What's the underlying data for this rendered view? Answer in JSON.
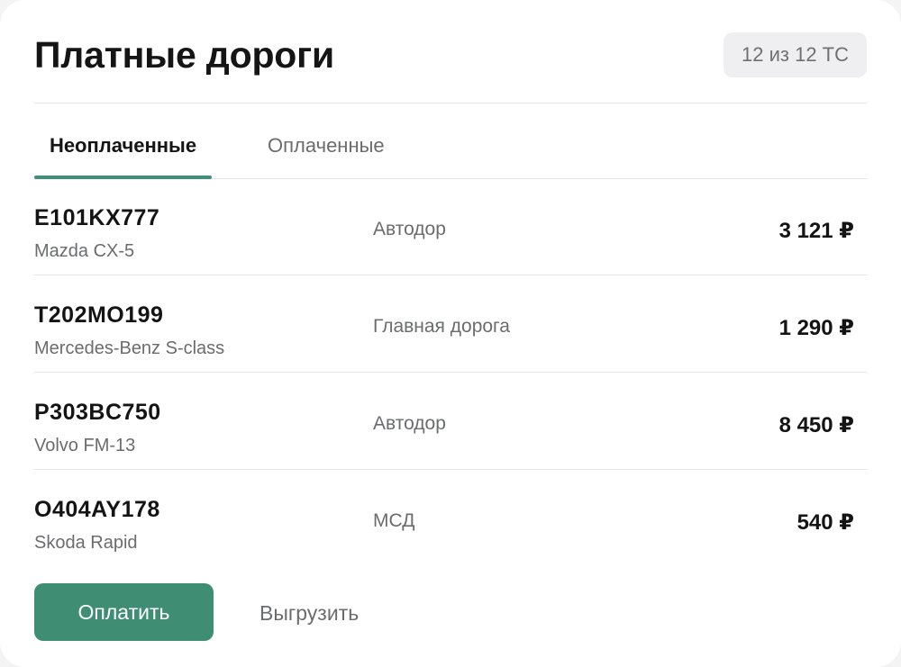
{
  "header": {
    "title": "Платные дороги",
    "count_badge": "12 из 12 ТС"
  },
  "tabs": [
    {
      "label": "Неоплаченные",
      "active": true
    },
    {
      "label": "Оплаченные",
      "active": false
    }
  ],
  "rows": [
    {
      "plate": "E101KX777",
      "model": "Mazda CX-5",
      "operator": "Автодор",
      "amount": "3 121 ₽"
    },
    {
      "plate": "T202MO199",
      "model": "Mercedes-Benz S-class",
      "operator": "Главная дорога",
      "amount": "1 290 ₽"
    },
    {
      "plate": "P303BC750",
      "model": "Volvo FM-13",
      "operator": "Автодор",
      "amount": "8 450 ₽"
    },
    {
      "plate": "O404AY178",
      "model": "Skoda Rapid",
      "operator": "МСД",
      "amount": "540 ₽"
    }
  ],
  "actions": {
    "pay_label": "Оплатить",
    "export_label": "Выгрузить"
  },
  "colors": {
    "accent": "#3f8d72",
    "badge_bg": "#efeff1",
    "muted_text": "#6b6c6e"
  }
}
